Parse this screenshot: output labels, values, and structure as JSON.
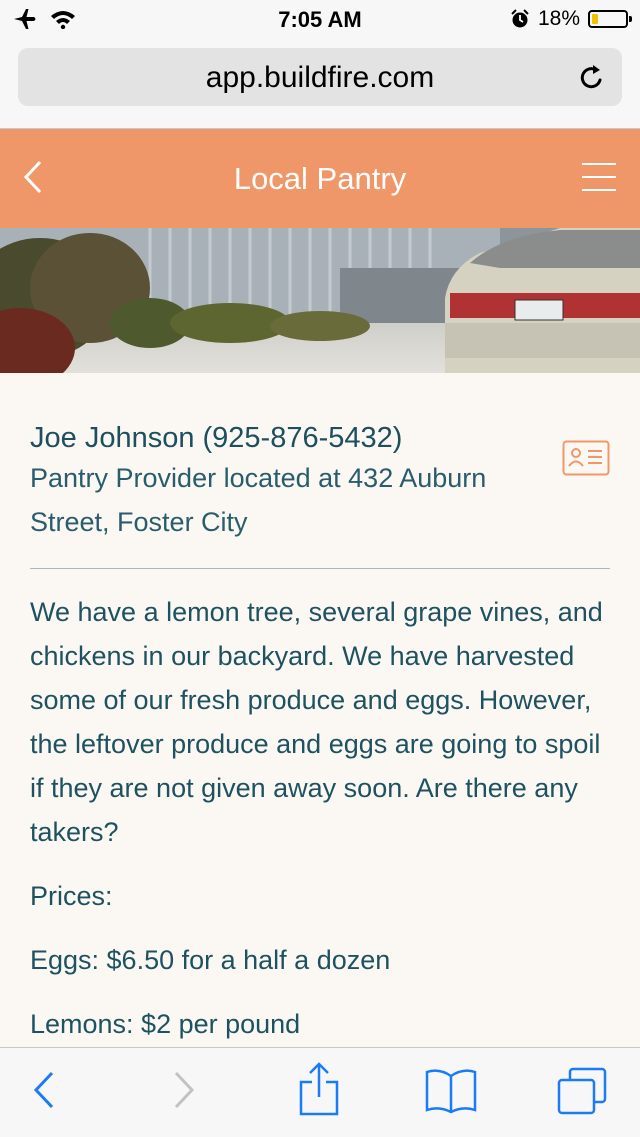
{
  "status_bar": {
    "time": "7:05 AM",
    "battery_percent": "18%",
    "battery_level": 0.18
  },
  "browser": {
    "url": "app.buildfire.com"
  },
  "app_header": {
    "title": "Local Pantry"
  },
  "listing": {
    "name": "Joe Johnson (925-876-5432)",
    "subtitle": "Pantry Provider located at 432 Auburn Street, Foster City",
    "description": "We have a lemon tree, several grape vines, and chickens in our backyard. We have harvested some of our fresh produce and eggs. However, the leftover produce and eggs are going to spoil if they are not given away soon. Are there any takers?",
    "prices_label": "Prices:",
    "price_eggs": "Eggs: $6.50 for a half a dozen",
    "price_lemons": "Lemons: $2 per pound"
  },
  "colors": {
    "header": "#f0976a",
    "accent_text": "#1f5260",
    "toolbar_icons": "#1a7cf5"
  }
}
